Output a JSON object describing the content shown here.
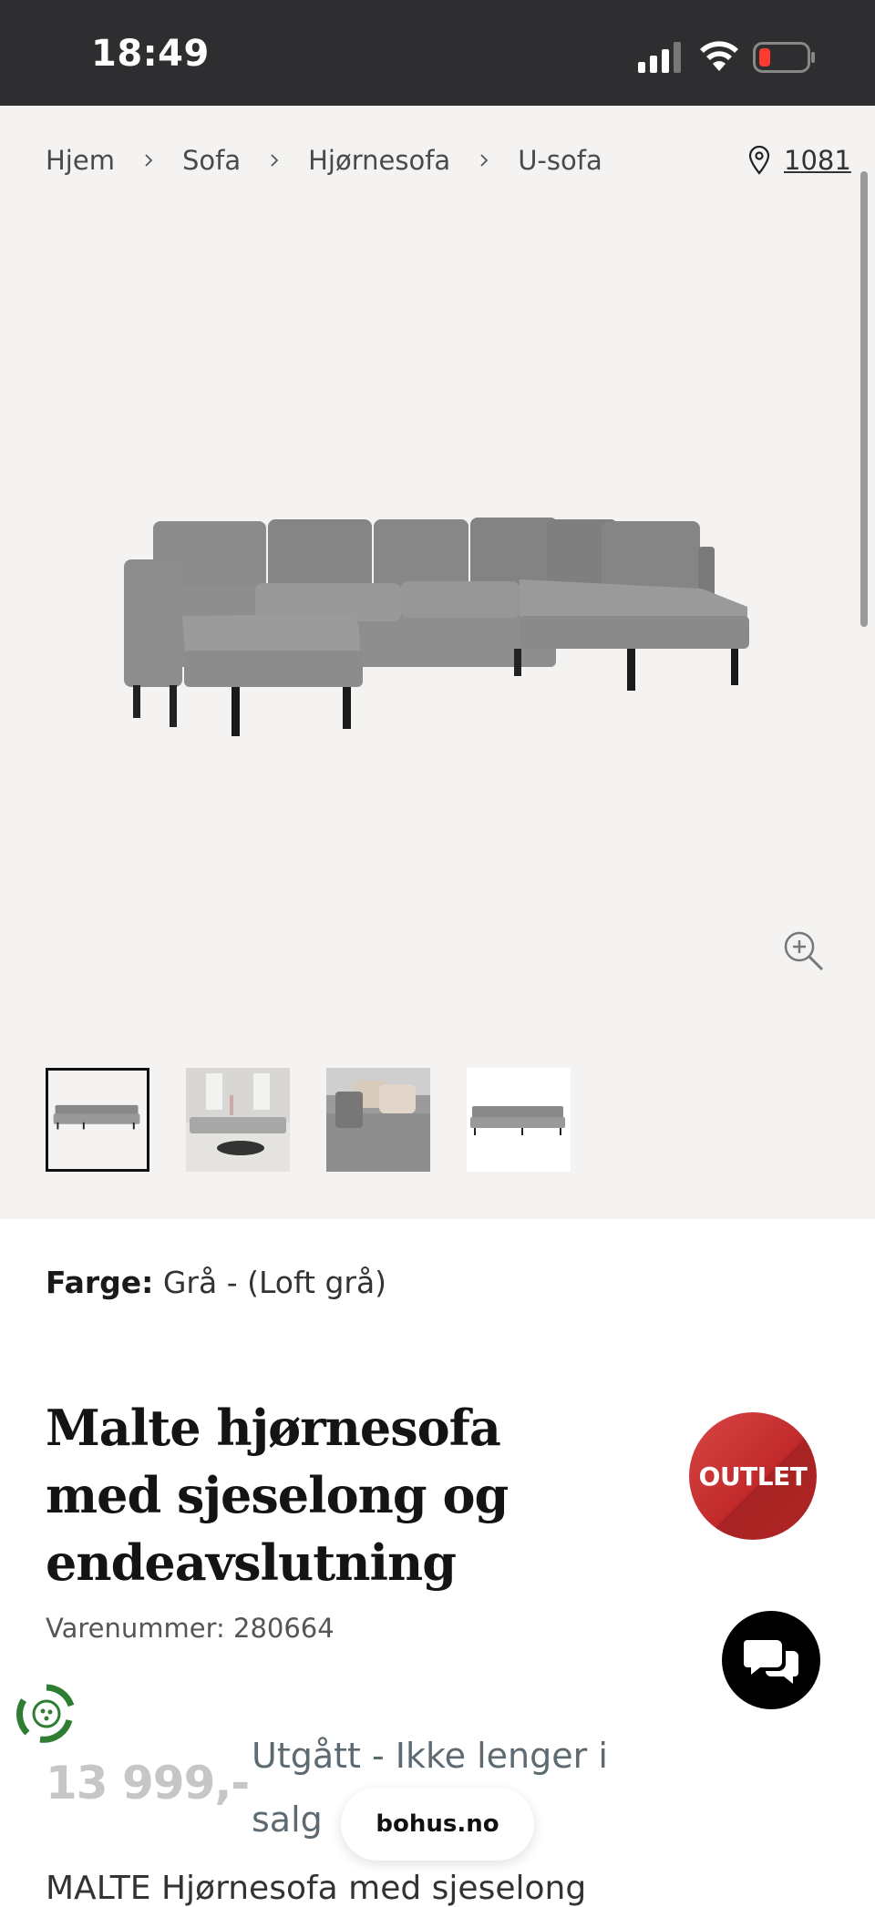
{
  "status_bar": {
    "time": "18:49"
  },
  "breadcrumb": {
    "items": [
      "Hjem",
      "Sofa",
      "Hjørnesofa",
      "U-sofa"
    ],
    "postcode": "1081"
  },
  "gallery": {
    "thumbnail_count": 4,
    "selected_index": 0
  },
  "product": {
    "color_label": "Farge:",
    "color_value": "Grå - (Loft grå)",
    "title": "Malte hjørnesofa med sjeselong og endeavslutning",
    "sku": "Varenummer: 280664",
    "badge": "OUTLET",
    "price": "13 999,-",
    "availability": "Utgått - Ikke lenger i salg",
    "description_peek": "MALTE Hjørnesofa med sjeselong"
  },
  "footer": {
    "site_label": "bohus.no"
  },
  "colors": {
    "status_bar_bg": "#2e2e31",
    "gallery_bg": "#f4f3f1",
    "outlet_red": "#c12a2a",
    "price_grey": "#c6c6c6",
    "availability_text": "#5e6a72"
  },
  "icons": [
    "signal-icon",
    "wifi-icon",
    "battery-icon",
    "chevron-right-icon",
    "location-pin-icon",
    "zoom-in-icon",
    "chat-icon",
    "sustainability-icon"
  ]
}
